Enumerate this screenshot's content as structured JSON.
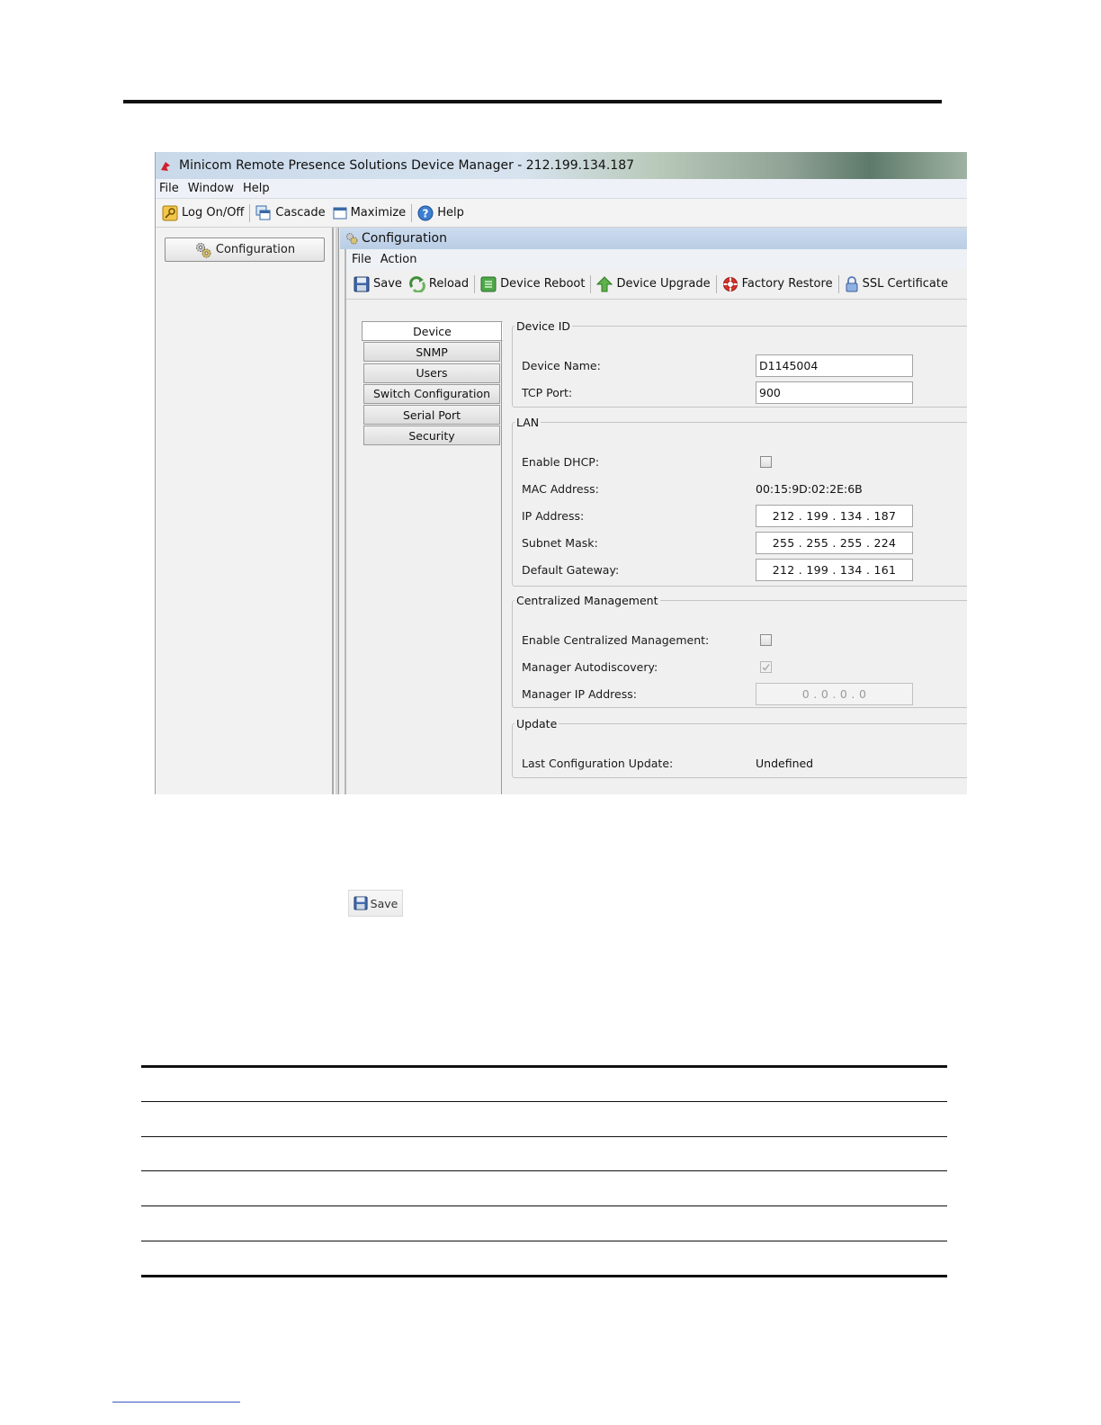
{
  "window": {
    "title": "Minicom Remote Presence Solutions Device Manager - 212.199.134.187",
    "menu": [
      "File",
      "Window",
      "Help"
    ],
    "toolbar": {
      "logon": "Log On/Off",
      "cascade": "Cascade",
      "maximize": "Maximize",
      "help": "Help"
    }
  },
  "sidebar": {
    "config_button": "Configuration"
  },
  "config_panel": {
    "title": "Configuration",
    "menu": [
      "File",
      "Action"
    ],
    "toolbar": {
      "save": "Save",
      "reload": "Reload",
      "reboot": "Device Reboot",
      "upgrade": "Device Upgrade",
      "factory": "Factory Restore",
      "ssl": "SSL Certificate"
    },
    "tabs": [
      "Device",
      "SNMP",
      "Users",
      "Switch Configuration",
      "Serial Port",
      "Security"
    ],
    "active_tab": "Device"
  },
  "device_id": {
    "legend": "Device ID",
    "device_name_label": "Device Name:",
    "device_name_value": "D1145004",
    "tcp_port_label": "TCP Port:",
    "tcp_port_value": "900"
  },
  "lan": {
    "legend": "LAN",
    "dhcp_label": "Enable DHCP:",
    "dhcp_checked": false,
    "mac_label": "MAC Address:",
    "mac_value": "00:15:9D:02:2E:6B",
    "ip_label": "IP Address:",
    "ip_value": "212 . 199 . 134 . 187",
    "mask_label": "Subnet Mask:",
    "mask_value": "255 . 255 . 255 . 224",
    "gateway_label": "Default Gateway:",
    "gateway_value": "212 . 199 . 134 . 161"
  },
  "central": {
    "legend": "Centralized Management",
    "enable_label": "Enable Centralized Management:",
    "enable_checked": false,
    "autodisc_label": "Manager Autodiscovery:",
    "autodisc_checked": true,
    "manager_ip_label": "Manager IP Address:",
    "manager_ip_value": "0 . 0 . 0 . 0"
  },
  "update": {
    "legend": "Update",
    "last_label": "Last Configuration Update:",
    "last_value": "Undefined"
  },
  "save_sample": {
    "label": "Save"
  }
}
